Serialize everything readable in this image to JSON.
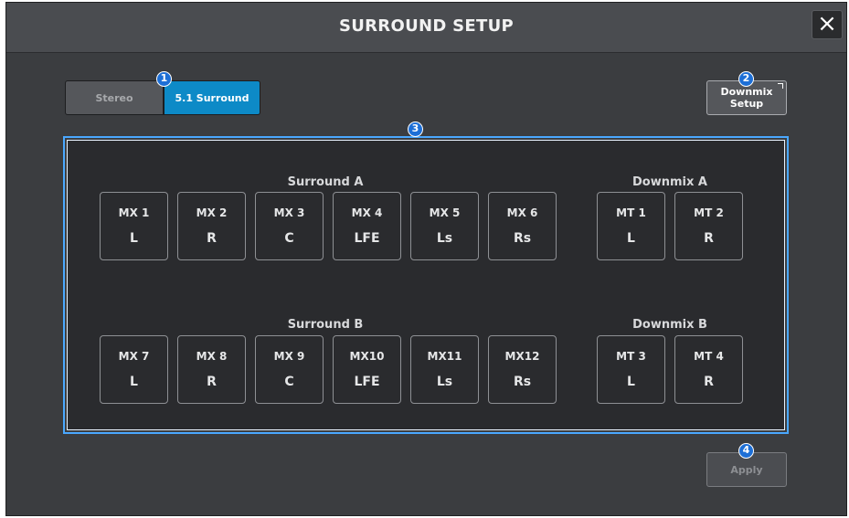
{
  "window": {
    "title": "SURROUND SETUP",
    "close_symbol": "×"
  },
  "mode": {
    "stereo_label": "Stereo",
    "surround_label": "5.1 Surround",
    "selected": "5.1 Surround"
  },
  "downmix_setup": {
    "line1": "Downmix",
    "line2": "Setup"
  },
  "apply_label": "Apply",
  "callouts": [
    "1",
    "2",
    "3",
    "4"
  ],
  "groups": {
    "surround_a": {
      "label": "Surround A",
      "channels": [
        {
          "bus": "MX 1",
          "pos": "L"
        },
        {
          "bus": "MX 2",
          "pos": "R"
        },
        {
          "bus": "MX 3",
          "pos": "C"
        },
        {
          "bus": "MX 4",
          "pos": "LFE"
        },
        {
          "bus": "MX 5",
          "pos": "Ls"
        },
        {
          "bus": "MX 6",
          "pos": "Rs"
        }
      ]
    },
    "downmix_a": {
      "label": "Downmix A",
      "channels": [
        {
          "bus": "MT 1",
          "pos": "L"
        },
        {
          "bus": "MT 2",
          "pos": "R"
        }
      ]
    },
    "surround_b": {
      "label": "Surround B",
      "channels": [
        {
          "bus": "MX 7",
          "pos": "L"
        },
        {
          "bus": "MX 8",
          "pos": "R"
        },
        {
          "bus": "MX 9",
          "pos": "C"
        },
        {
          "bus": "MX10",
          "pos": "LFE"
        },
        {
          "bus": "MX11",
          "pos": "Ls"
        },
        {
          "bus": "MX12",
          "pos": "Rs"
        }
      ]
    },
    "downmix_b": {
      "label": "Downmix B",
      "channels": [
        {
          "bus": "MT 3",
          "pos": "L"
        },
        {
          "bus": "MT 4",
          "pos": "R"
        }
      ]
    }
  },
  "colors": {
    "accent": "#0d8ac7",
    "callout": "#1d6fd6",
    "panel_highlight": "#4aa8ff"
  }
}
